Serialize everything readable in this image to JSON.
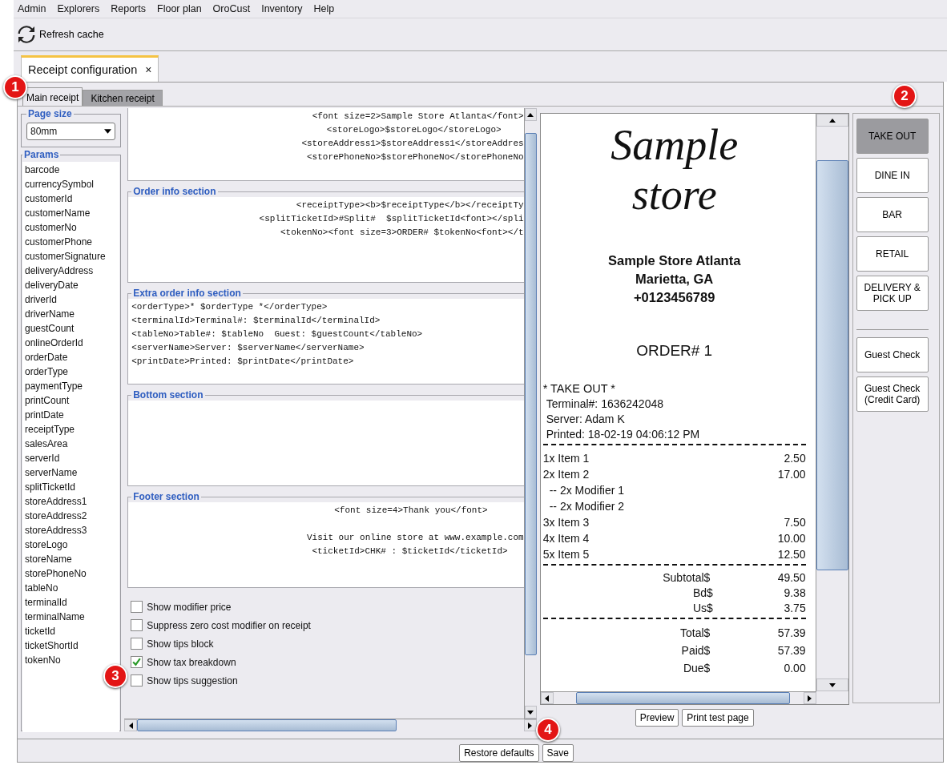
{
  "menu": [
    "Admin",
    "Explorers",
    "Reports",
    "Floor plan",
    "OroCust",
    "Inventory",
    "Help"
  ],
  "toolbar": {
    "refresh": "Refresh cache"
  },
  "doc_tab": {
    "title": "Receipt configuration",
    "close": "×"
  },
  "tabs": [
    {
      "label": "Main receipt",
      "selected": true
    },
    {
      "label": "Kitchen receipt",
      "selected": false
    }
  ],
  "page_size": {
    "legend": "Page size",
    "value": "80mm"
  },
  "params": {
    "legend": "Params",
    "items": [
      "barcode",
      "currencySymbol",
      "customerId",
      "customerName",
      "customerNo",
      "customerPhone",
      "customerSignature",
      "deliveryAddress",
      "deliveryDate",
      "driverId",
      "driverName",
      "guestCount",
      "onlineOrderId",
      "orderDate",
      "orderType",
      "paymentType",
      "printCount",
      "printDate",
      "receiptType",
      "salesArea",
      "serverId",
      "serverName",
      "splitTicketId",
      "storeAddress1",
      "storeAddress2",
      "storeAddress3",
      "storeLogo",
      "storeName",
      "storePhoneNo",
      "tableNo",
      "terminalId",
      "terminalName",
      "ticketId",
      "ticketShortId",
      "tokenNo"
    ]
  },
  "sections": [
    {
      "lines": [
        "<font size=2>Sample Store Atlanta</font>",
        "<storeLogo>$storeLogo</storeLogo>",
        "<storeAddress1>$storeAddress1</storeAddres",
        "<storePhoneNo>$storePhoneNo</storePhoneNo"
      ]
    },
    {
      "title": "Order info section",
      "lines": [
        "<receiptType><b>$receiptType</b></receiptTy",
        "<splitTicketId>#Split#  $splitTicketId<font></spli",
        "<tokenNo><font size=3>ORDER# $tokenNo<font></t"
      ]
    },
    {
      "title": "Extra order info section",
      "lines": [
        "<orderType>* $orderType *</orderType>",
        "<terminalId>Terminal#: $terminalId</terminalId>",
        "<tableNo>Table#: $tableNo  Guest: $guestCount</tableNo>",
        "<serverName>Server: $serverName</serverName>",
        "<printDate>Printed: $printDate</printDate>"
      ]
    },
    {
      "title": "Bottom section"
    },
    {
      "title": "Footer section",
      "lines": [
        "<font size=4>Thank you</font>",
        "Visit our online store at www.example.com",
        "<ticketId>CHK# : $ticketId</ticketId>"
      ]
    }
  ],
  "options": [
    {
      "label": "Show modifier price",
      "checked": false
    },
    {
      "label": "Suppress zero cost modifier on receipt",
      "checked": false
    },
    {
      "label": "Show tips block",
      "checked": false
    },
    {
      "label": "Show tax breakdown",
      "checked": true
    },
    {
      "label": "Show tips suggestion",
      "checked": false
    }
  ],
  "receipt": {
    "logo": "Sample store",
    "header": [
      "Sample Store Atlanta",
      "Marietta, GA",
      "+0123456789"
    ],
    "order": "ORDER# 1",
    "order_type": "* TAKE OUT *",
    "info": [
      "Terminal#: 1636242048",
      "Server: Adam K",
      "Printed: 18-02-19 04:06:12 PM"
    ],
    "items": [
      {
        "kind": "item",
        "name": "1x Item 1",
        "price": "2.50"
      },
      {
        "kind": "item",
        "name": "2x Item 2",
        "price": "17.00"
      },
      {
        "kind": "modifier",
        "name": "-- 2x Modifier 1"
      },
      {
        "kind": "modifier",
        "name": "-- 2x Modifier 2"
      },
      {
        "kind": "item",
        "name": "3x Item 3",
        "price": "7.50"
      },
      {
        "kind": "item",
        "name": "4x Item 4",
        "price": "10.00"
      },
      {
        "kind": "item",
        "name": "5x Item 5",
        "price": "12.50"
      }
    ],
    "subtotals": [
      {
        "label": "Subtotal$",
        "value": "49.50"
      },
      {
        "label": "Bd$",
        "value": "9.38"
      },
      {
        "label": "Us$",
        "value": "3.75"
      }
    ],
    "totals": [
      {
        "label": "Total$",
        "value": "57.39"
      },
      {
        "label": "Paid$",
        "value": "57.39"
      },
      {
        "label": "Due$",
        "value": "0.00"
      }
    ]
  },
  "order_types": [
    {
      "label": "TAKE OUT",
      "selected": true
    },
    {
      "label": "DINE IN",
      "selected": false
    },
    {
      "label": "BAR",
      "selected": false
    },
    {
      "label": "RETAIL",
      "selected": false
    },
    {
      "label": "DELIVERY & PICK UP",
      "selected": false
    }
  ],
  "check_buttons": [
    "Guest Check",
    "Guest Check (Credit Card)"
  ],
  "preview_buttons": [
    "Preview",
    "Print test page"
  ],
  "bottom_buttons": [
    "Restore defaults",
    "Save"
  ],
  "callouts": [
    "1",
    "2",
    "3",
    "4"
  ]
}
